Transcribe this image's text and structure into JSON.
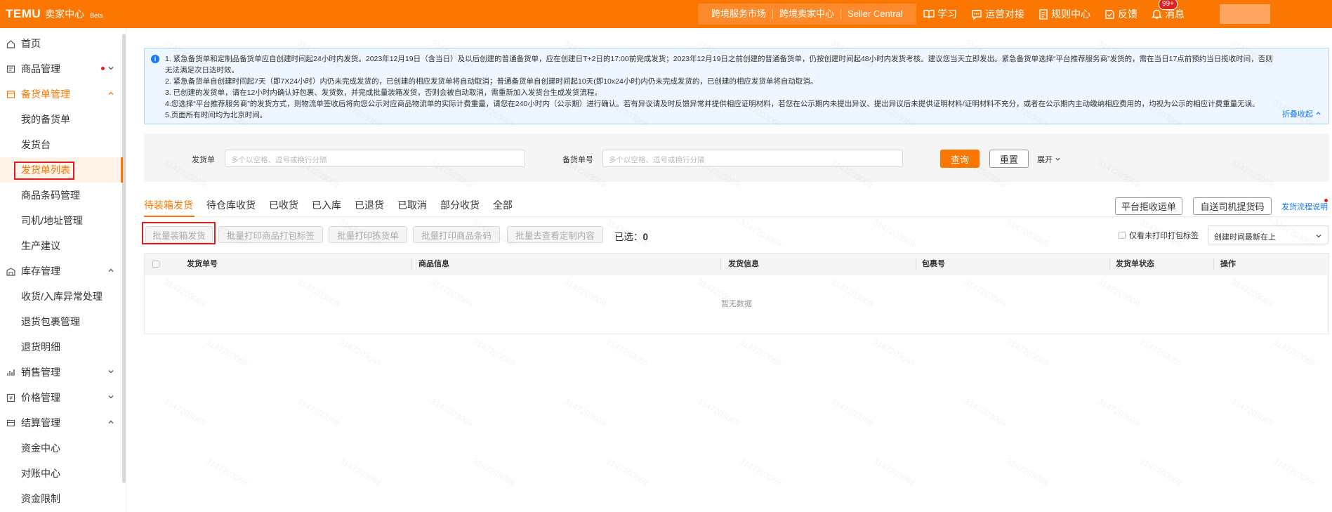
{
  "topbar": {
    "brand": "TEMU",
    "subtitle": "卖家中心",
    "beta": "Beta",
    "nav": [
      "跨境服务市场",
      "跨境卖家中心",
      "Seller Central"
    ],
    "icons": [
      {
        "label": "学习",
        "icon": "book-icon"
      },
      {
        "label": "运营对接",
        "icon": "chat-icon"
      },
      {
        "label": "规则中心",
        "icon": "rules-icon"
      },
      {
        "label": "反馈",
        "icon": "feedback-icon"
      },
      {
        "label": "消息",
        "icon": "bell-icon"
      }
    ],
    "message_badge": "99+",
    "accent_color": "#fb7701"
  },
  "sidebar": {
    "items": [
      {
        "label": "首页",
        "icon": "home-icon"
      },
      {
        "label": "商品管理",
        "icon": "goods-icon"
      },
      {
        "label": "备货单管理",
        "icon": "order-icon"
      },
      {
        "label": "我的备货单"
      },
      {
        "label": "发货台"
      },
      {
        "label": "发货单列表"
      },
      {
        "label": "商品条码管理"
      },
      {
        "label": "司机/地址管理"
      },
      {
        "label": "生产建议"
      },
      {
        "label": "库存管理",
        "icon": "warehouse-icon"
      },
      {
        "label": "收货/入库异常处理"
      },
      {
        "label": "退货包裹管理"
      },
      {
        "label": "退货明细"
      },
      {
        "label": "销售管理",
        "icon": "sales-icon"
      },
      {
        "label": "价格管理",
        "icon": "price-icon"
      },
      {
        "label": "结算管理",
        "icon": "settlement-icon"
      },
      {
        "label": "资金中心"
      },
      {
        "label": "对账中心"
      },
      {
        "label": "资金限制"
      }
    ]
  },
  "notice": {
    "lines": [
      "1. 紧急备货单和定制品备货单应自创建时间起24小时内发货。2023年12月19日（含当日）及以后创建的普通备货单，应在创建日T+2日的17:00前完成发货；2023年12月19日之前创建的普通备货单，仍按创建时间起48小时内发货考核。建议您当天立即发出。紧急备货单选择“平台推荐服务商”发货的，需在当日17点前预约当日揽收时间，否则",
      "无法满足次日达时效。",
      "2. 紧急备货单自创建时间起7天（即7X24小时）内仍未完成发货的，已创建的相应发货单将自动取消；普通备货单自创建时间起10天(即10x24小时)内仍未完成发货的，已创建的相应发货单将自动取消。",
      "3. 已创建的发货单，请在12小时内确认好包裹、发货数，并完成批量装箱发货，否则会被自动取消，需重新加入发货台生成发货流程。",
      "4.您选择“平台推荐服务商”的发货方式，则物流单签收后将向您公示对应商品物流单的实际计费重量，请您在240小时内（公示期）进行确认。若有异议请及时反馈异常并提供相应证明材料，若您在公示期内未提出异议、提出异议后未提供证明材料/证明材料不充分，或者在公示期内主动缴纳相应费用的，均视为公示的相应计费重量无误。",
      "5.页面所有时间均为北京时间。"
    ],
    "collapse": "折叠收起"
  },
  "search": {
    "ship_label": "发货单",
    "ship_placeholder": "多个以空格、逗号或换行分隔",
    "stock_label": "备货单号",
    "stock_placeholder": "多个以空格、逗号或换行分隔",
    "query": "查询",
    "reset": "重置",
    "expand": "展开"
  },
  "tabs": [
    "待装箱发货",
    "待仓库收货",
    "已收货",
    "已入库",
    "已退货",
    "已取消",
    "部分收货",
    "全部"
  ],
  "right_actions": {
    "reject": "平台拒收运单",
    "pickup_code": "自送司机提货码",
    "flow_link": "发货流程说明"
  },
  "actions": {
    "buttons": [
      "批量装箱发货",
      "批量打印商品打包标签",
      "批量打印拣货单",
      "批量打印商品条码",
      "批量去查看定制内容"
    ],
    "selected_label": "已选：",
    "selected_count": "0",
    "only_unprinted": "仅看未打印打包标签",
    "sort": "创建时间最新在上"
  },
  "table": {
    "columns": [
      "发货单号",
      "商品信息",
      "发货信息",
      "包裹号",
      "发货单状态",
      "操作"
    ],
    "empty": "暂无数据"
  },
  "watermark": "3147203069"
}
